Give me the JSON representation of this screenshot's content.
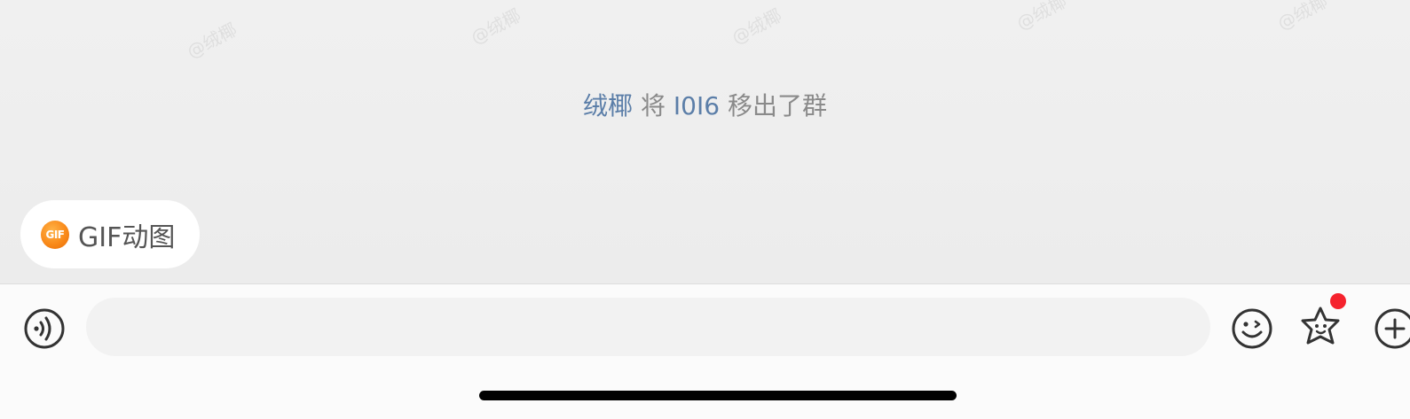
{
  "watermark": {
    "text": "@绒椰"
  },
  "chat": {
    "system_message": {
      "actor": "绒椰",
      "verb": "将",
      "target": "I0I6",
      "action": "移出了群"
    }
  },
  "suggestion_chip": {
    "badge": "GIF",
    "label": "GIF动图"
  },
  "input_bar": {
    "message_value": "",
    "voice_icon": "voice-icon",
    "emoji_icon": "smile-icon",
    "sticker_icon": "star-face-icon",
    "more_icon": "plus-icon",
    "notification_color": "#f5222d"
  },
  "colors": {
    "name_link": "#5b7ea8",
    "system_text": "#8a8a8a",
    "gif_badge": "#f98a1a"
  }
}
